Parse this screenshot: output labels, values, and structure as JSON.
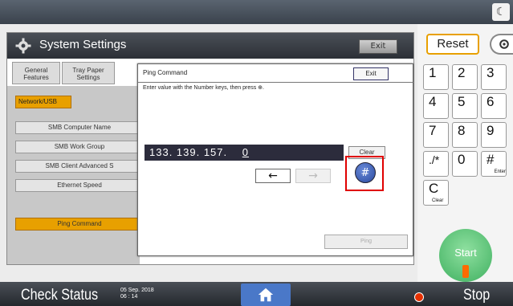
{
  "settings": {
    "title": "System Settings",
    "exit_label": "Exit",
    "tabs": [
      {
        "label": "General\nFeatures"
      },
      {
        "label": "Tray Paper\nSettings"
      }
    ],
    "category": "Network/USB",
    "menu": [
      {
        "label": "SMB Computer Name"
      },
      {
        "label": "SMB Work Group"
      },
      {
        "label": "SMB Client Advanced S"
      },
      {
        "label": "Ethernet Speed"
      }
    ],
    "active_item": "Ping Command"
  },
  "dialog": {
    "title": "Ping Command",
    "exit_label": "Exit",
    "instruction": "Enter value with the Number keys, then press ⊕.",
    "ip_value": "133. 139. 157.",
    "ip_cursor": "0",
    "clear_label": "Clear",
    "back_arrow": "←",
    "forward_arrow": "→",
    "hash_label": "#",
    "ping_label": "Ping"
  },
  "status_bar": {
    "check_status": "Check Status",
    "date": "05 Sep. 2018",
    "time": "06 : 14",
    "stop_label": "Stop"
  },
  "keypad": {
    "reset_label": "Reset",
    "keys": [
      {
        "label": "1"
      },
      {
        "label": "2"
      },
      {
        "label": "3"
      },
      {
        "label": "4"
      },
      {
        "label": "5"
      },
      {
        "label": "6"
      },
      {
        "label": "7"
      },
      {
        "label": "8"
      },
      {
        "label": "9"
      },
      {
        "label": "./*"
      },
      {
        "label": "0"
      },
      {
        "label": "#",
        "sub": "Enter"
      },
      {
        "label": "C",
        "sub": "Clear"
      }
    ],
    "start_label": "Start"
  },
  "colors": {
    "accent_orange": "#e8a000",
    "highlight_red": "#e00000",
    "start_green": "#3fb060"
  }
}
